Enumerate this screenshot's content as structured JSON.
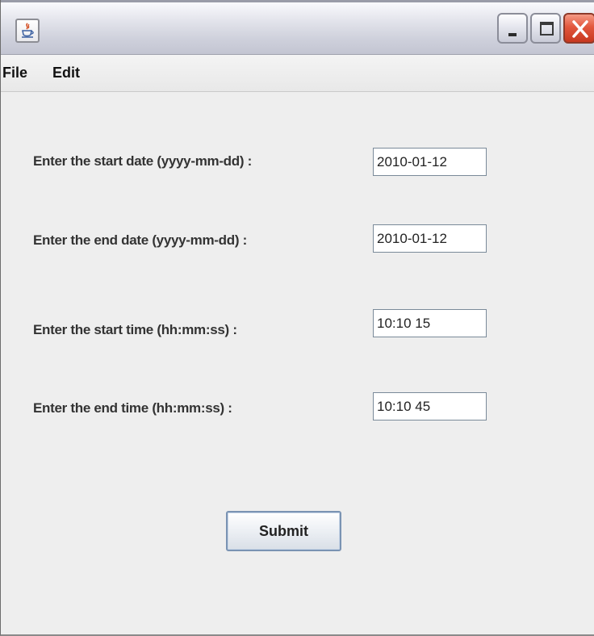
{
  "menubar": {
    "file_label": "File",
    "edit_label": "Edit"
  },
  "form": {
    "start_date_label": "Enter the start date (yyyy-mm-dd) :",
    "start_date_value": "2010-01-12",
    "end_date_label": "Enter the end date (yyyy-mm-dd) :",
    "end_date_value": "2010-01-12",
    "start_time_label": "Enter the start time (hh:mm:ss) :",
    "start_time_value": "10:10 15",
    "end_time_label": "Enter the end time (hh:mm:ss) :",
    "end_time_value": "10:10 45",
    "submit_label": "Submit"
  },
  "icons": {
    "app": "java-cup-icon",
    "minimize": "minimize-icon",
    "maximize": "maximize-icon",
    "close": "close-icon"
  },
  "colors": {
    "window_bg": "#eeeeee",
    "close_button": "#e2573d",
    "field_border": "#7a8a99"
  }
}
